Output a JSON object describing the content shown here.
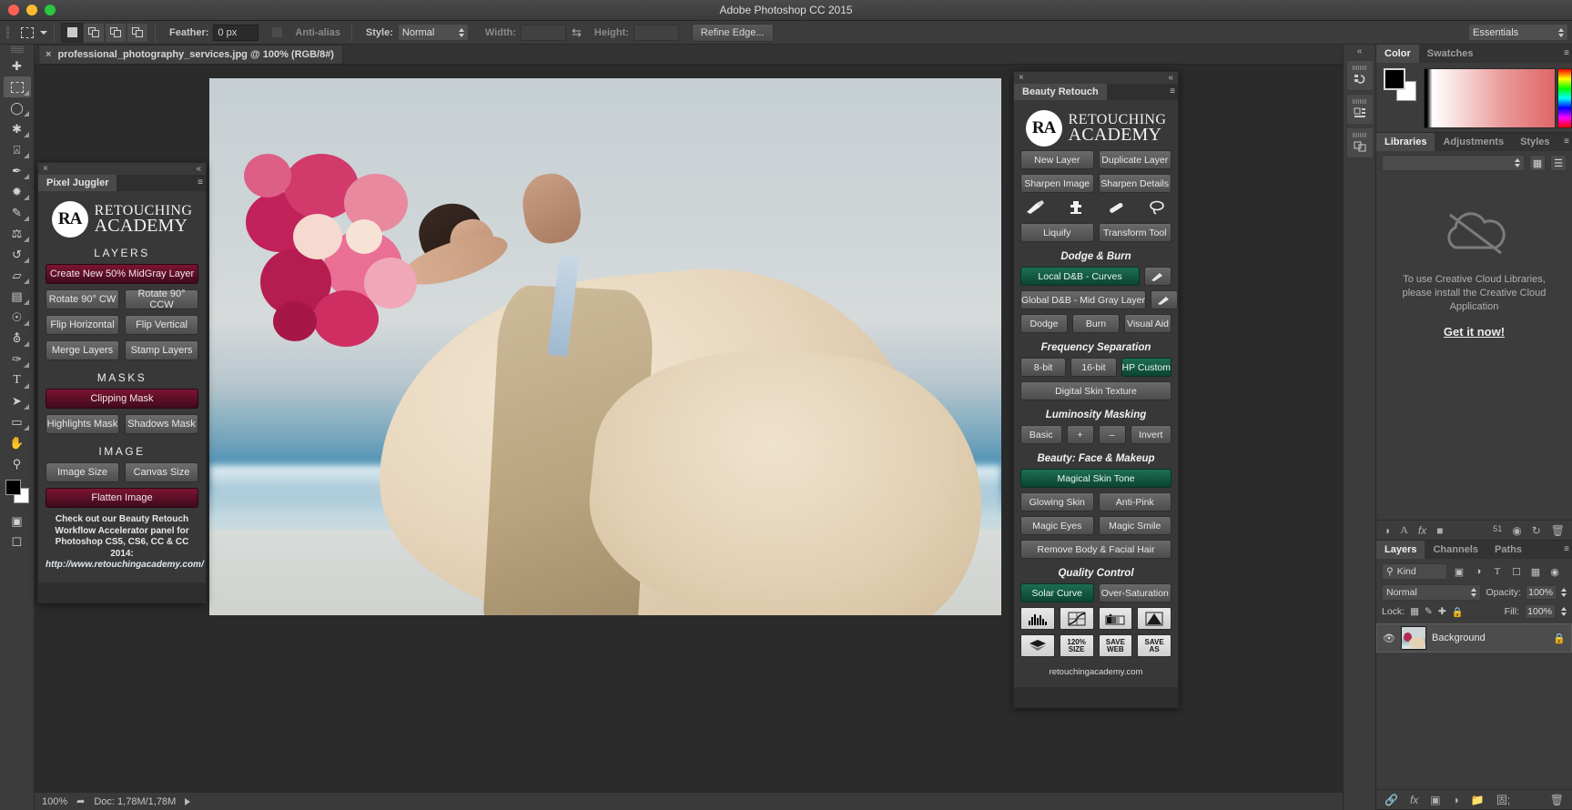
{
  "window": {
    "title": "Adobe Photoshop CC 2015",
    "traffic": [
      "close",
      "minimize",
      "maximize"
    ]
  },
  "options_bar": {
    "tool_icon": "marquee-icon",
    "mode_buttons": [
      "new-selection",
      "add-to-selection",
      "subtract-from-selection",
      "intersect-selection"
    ],
    "feather_label": "Feather:",
    "feather_value": "0 px",
    "antialias_label": "Anti-alias",
    "antialias_checked": false,
    "style_label": "Style:",
    "style_value": "Normal",
    "width_label": "Width:",
    "width_value": "",
    "swap_icon": "swap-icon",
    "height_label": "Height:",
    "height_value": "",
    "refine_edge_label": "Refine Edge...",
    "workspace_value": "Essentials"
  },
  "tools": [
    {
      "name": "move-tool",
      "glyph": "✚"
    },
    {
      "name": "marquee-tool",
      "glyph": "⬚"
    },
    {
      "name": "lasso-tool",
      "glyph": "❦"
    },
    {
      "name": "quick-selection-tool",
      "glyph": "✐"
    },
    {
      "name": "crop-tool",
      "glyph": "⌗"
    },
    {
      "name": "eyedropper-tool",
      "glyph": "✒"
    },
    {
      "name": "spot-healing-tool",
      "glyph": "❁"
    },
    {
      "name": "brush-tool",
      "glyph": "✎"
    },
    {
      "name": "clone-stamp-tool",
      "glyph": "⚓"
    },
    {
      "name": "history-brush-tool",
      "glyph": "↺"
    },
    {
      "name": "eraser-tool",
      "glyph": "▱"
    },
    {
      "name": "gradient-tool",
      "glyph": "▤"
    },
    {
      "name": "blur-tool",
      "glyph": "Ὂ7"
    },
    {
      "name": "dodge-tool",
      "glyph": "⚲"
    },
    {
      "name": "pen-tool",
      "glyph": "✑"
    },
    {
      "name": "type-tool",
      "glyph": "T"
    },
    {
      "name": "path-selection-tool",
      "glyph": "➤"
    },
    {
      "name": "rectangle-tool",
      "glyph": "▭"
    },
    {
      "name": "hand-tool",
      "glyph": "✋"
    },
    {
      "name": "zoom-tool",
      "glyph": "⚲"
    }
  ],
  "tools_extra": [
    {
      "name": "edit-in-quick-mask-tool",
      "glyph": "▣"
    },
    {
      "name": "screen-mode-tool",
      "glyph": "❐"
    }
  ],
  "document": {
    "tab_title": "professional_photography_services.jpg @ 100% (RGB/8#)",
    "close_glyph": "×"
  },
  "status_bar": {
    "zoom": "100%",
    "doc_info": "Doc: 1,78M/1,78M",
    "share_icon": "share-icon",
    "expand_icon": "expand-arrow-icon"
  },
  "pixel_juggler": {
    "panel_title": "Pixel Juggler",
    "close_glyph": "×",
    "collapse_glyph": "«",
    "menu_glyph": "☰",
    "logo": {
      "badge": "RA",
      "line1": "RETOUCHING",
      "line2": "ACADEMY"
    },
    "sections": [
      {
        "title": "LAYERS",
        "rows": [
          [
            {
              "label": "Create New 50% MidGray Layer",
              "style": "red"
            }
          ],
          [
            {
              "label": "Rotate 90° CW",
              "style": "gray"
            },
            {
              "label": "Rotate 90° CCW",
              "style": "gray"
            }
          ],
          [
            {
              "label": "Flip Horizontal",
              "style": "gray"
            },
            {
              "label": "Flip Vertical",
              "style": "gray"
            }
          ],
          [
            {
              "label": "Merge Layers",
              "style": "gray"
            },
            {
              "label": "Stamp Layers",
              "style": "gray"
            }
          ]
        ]
      },
      {
        "title": "MASKS",
        "rows": [
          [
            {
              "label": "Clipping Mask",
              "style": "red"
            }
          ],
          [
            {
              "label": "Highlights Mask",
              "style": "gray"
            },
            {
              "label": "Shadows Mask",
              "style": "gray"
            }
          ]
        ]
      },
      {
        "title": "IMAGE",
        "rows": [
          [
            {
              "label": "Image Size",
              "style": "gray"
            },
            {
              "label": "Canvas Size",
              "style": "gray"
            }
          ],
          [
            {
              "label": "Flatten Image",
              "style": "red"
            }
          ]
        ]
      }
    ],
    "note_line1": "Check out our Beauty Retouch",
    "note_line2": "Workflow Accelerator panel for",
    "note_line3": "Photoshop CS5, CS6, CC & CC 2014:",
    "note_url": "http://www.retouchingacademy.com/"
  },
  "beauty_retouch": {
    "panel_title": "Beauty Retouch",
    "close_glyph": "×",
    "collapse_glyph": "«",
    "menu_glyph": "☰",
    "logo": {
      "badge": "RA",
      "line1": "RETOUCHING",
      "line2": "ACADEMY"
    },
    "top_rows": [
      [
        {
          "label": "New Layer",
          "style": "gray"
        },
        {
          "label": "Duplicate Layer",
          "style": "gray"
        }
      ],
      [
        {
          "label": "Sharpen Image",
          "style": "gray"
        },
        {
          "label": "Sharpen Details",
          "style": "gray"
        }
      ]
    ],
    "tool_icons": [
      "brush-icon",
      "clone-stamp-icon",
      "healing-brush-icon",
      "lasso-icon"
    ],
    "tool_row": [
      {
        "label": "Liquify",
        "style": "gray"
      },
      {
        "label": "Transform Tool",
        "style": "gray"
      }
    ],
    "sections": [
      {
        "title": "Dodge & Burn",
        "rows": [
          [
            {
              "label": "Local D&B - Curves",
              "style": "green",
              "has_swatch": true
            }
          ],
          [
            {
              "label": "Global D&B - Mid Gray Layer",
              "style": "gray",
              "has_swatch": true
            }
          ],
          [
            {
              "label": "Dodge",
              "style": "gray"
            },
            {
              "label": "Burn",
              "style": "gray"
            },
            {
              "label": "Visual Aid",
              "style": "gray"
            }
          ]
        ]
      },
      {
        "title": "Frequency Separation",
        "rows": [
          [
            {
              "label": "8-bit",
              "style": "gray"
            },
            {
              "label": "16-bit",
              "style": "gray"
            },
            {
              "label": "HP Custom",
              "style": "green"
            }
          ],
          [
            {
              "label": "Digital Skin Texture",
              "style": "gray"
            }
          ]
        ]
      },
      {
        "title": "Luminosity Masking",
        "rows": [
          [
            {
              "label": "Basic",
              "style": "gray"
            },
            {
              "label": "+",
              "style": "gray"
            },
            {
              "label": "–",
              "style": "gray"
            },
            {
              "label": "Invert",
              "style": "gray"
            }
          ]
        ]
      },
      {
        "title": "Beauty: Face & Makeup",
        "rows": [
          [
            {
              "label": "Magical Skin Tone",
              "style": "green"
            }
          ],
          [
            {
              "label": "Glowing Skin",
              "style": "gray"
            },
            {
              "label": "Anti-Pink",
              "style": "gray"
            }
          ],
          [
            {
              "label": "Magic Eyes",
              "style": "gray"
            },
            {
              "label": "Magic Smile",
              "style": "gray"
            }
          ],
          [
            {
              "label": "Remove Body & Facial Hair",
              "style": "gray"
            }
          ]
        ]
      },
      {
        "title": "Quality Control",
        "rows": [
          [
            {
              "label": "Solar Curve",
              "style": "green"
            },
            {
              "label": "Over-Saturation",
              "style": "gray"
            }
          ]
        ]
      }
    ],
    "tiles_row1": [
      {
        "name": "histogram-tile",
        "label": ""
      },
      {
        "name": "curves-tile",
        "label": ""
      },
      {
        "name": "gradient-map-tile",
        "label": ""
      },
      {
        "name": "export-tile",
        "label": ""
      }
    ],
    "tiles_row2": [
      {
        "name": "flatten-tile",
        "label": ""
      },
      {
        "name": "resize-120-tile",
        "label": "120%\nSIZE"
      },
      {
        "name": "save-web-tile",
        "label": "SAVE\nWEB"
      },
      {
        "name": "save-as-tile",
        "label": "SAVE\nAS"
      }
    ],
    "footer_url": "retouchingacademy.com"
  },
  "icon_dock": {
    "collapse_glyph": "«",
    "items": [
      "history-icon",
      "properties-icon",
      "actions-icon"
    ]
  },
  "color_panel": {
    "tabs": [
      {
        "label": "Color",
        "active": true
      },
      {
        "label": "Swatches",
        "active": false
      }
    ],
    "menu_glyph": "☰",
    "foreground": "#000000",
    "background": "#ffffff"
  },
  "libraries_panel": {
    "tabs": [
      {
        "label": "Libraries",
        "active": true
      },
      {
        "label": "Adjustments",
        "active": false
      },
      {
        "label": "Styles",
        "active": false
      }
    ],
    "menu_glyph": "☰",
    "selector_value": "",
    "empty_line1": "To use Creative Cloud Libraries,",
    "empty_line2": "please install the Creative Cloud",
    "empty_line3": "Application",
    "cta_label": "Get it now!",
    "cloud_icon": "cloud-off-icon",
    "footer_icons": [
      "adjustment-icon",
      "type-icon",
      "fx-icon",
      "color-chip-icon",
      "camera-icon",
      "sync-icon",
      "trash-icon"
    ],
    "footer_badge": "51"
  },
  "layers_panel": {
    "tabs": [
      {
        "label": "Layers",
        "active": true
      },
      {
        "label": "Channels",
        "active": false
      },
      {
        "label": "Paths",
        "active": false
      }
    ],
    "menu_glyph": "☰",
    "filter_kind_label": "Kind",
    "filter_icons": [
      "pixel-filter-icon",
      "adjustment-filter-icon",
      "type-filter-icon",
      "shape-filter-icon",
      "smart-filter-icon"
    ],
    "blend_mode": "Normal",
    "opacity_label": "Opacity:",
    "opacity_value": "100%",
    "lock_label": "Lock:",
    "lock_icons": [
      "lock-transparency-icon",
      "lock-image-icon",
      "lock-position-icon",
      "lock-all-icon"
    ],
    "fill_label": "Fill:",
    "fill_value": "100%",
    "rows": [
      {
        "name": "Background",
        "visible": true,
        "locked": true,
        "thumb": "photo-thumb"
      }
    ],
    "footer_icons": [
      "link-icon",
      "fx-icon",
      "mask-icon",
      "adjustment-icon",
      "group-icon",
      "new-layer-icon",
      "delete-icon"
    ]
  }
}
